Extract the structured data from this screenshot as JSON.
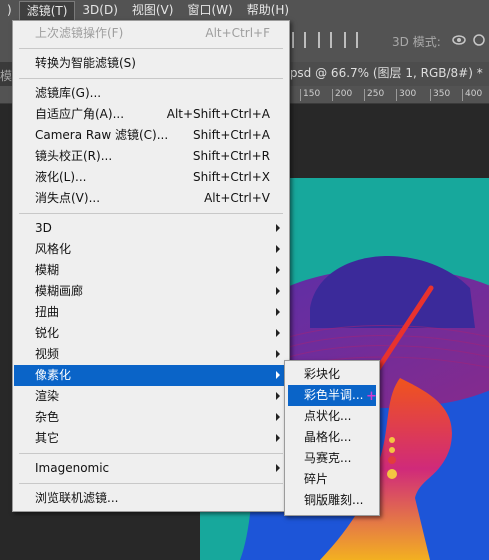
{
  "menubar": {
    "items": [
      ")",
      "滤镜(T)",
      "3D(D)",
      "视图(V)",
      "窗口(W)",
      "帮助(H)"
    ]
  },
  "optionsbar": {
    "mode_3d": "3D 模式:"
  },
  "document": {
    "left_fragment": "模",
    "tab_title": ".psd @ 66.7% (图层 1, RGB/8#) *"
  },
  "ruler": {
    "ticks": [
      "150",
      "200",
      "250",
      "300",
      "350",
      "400"
    ]
  },
  "filter_menu": {
    "last_filter": "上次滤镜操作(F)",
    "last_filter_shortcut": "Alt+Ctrl+F",
    "smart_filter": "转换为智能滤镜(S)",
    "gallery": "滤镜库(G)...",
    "adaptive_wide": "自适应广角(A)...",
    "adaptive_wide_shortcut": "Alt+Shift+Ctrl+A",
    "camera_raw": "Camera Raw 滤镜(C)...",
    "camera_raw_shortcut": "Shift+Ctrl+A",
    "lens_correction": "镜头校正(R)...",
    "lens_correction_shortcut": "Shift+Ctrl+R",
    "liquify": "液化(L)...",
    "liquify_shortcut": "Shift+Ctrl+X",
    "vanishing_point": "消失点(V)...",
    "vanishing_point_shortcut": "Alt+Ctrl+V",
    "groups": [
      "3D",
      "风格化",
      "模糊",
      "模糊画廊",
      "扭曲",
      "锐化",
      "视频",
      "像素化",
      "渲染",
      "杂色",
      "其它"
    ],
    "imagenomic": "Imagenomic",
    "browse_online": "浏览联机滤镜..."
  },
  "pixelate_submenu": {
    "items": [
      "彩块化",
      "彩色半调...",
      "点状化...",
      "晶格化...",
      "马赛克...",
      "碎片",
      "铜版雕刻..."
    ]
  },
  "colors": {
    "menu_bg": "#efefef",
    "highlight": "#0a64c8",
    "annotation_arrow": "#e8322e"
  }
}
